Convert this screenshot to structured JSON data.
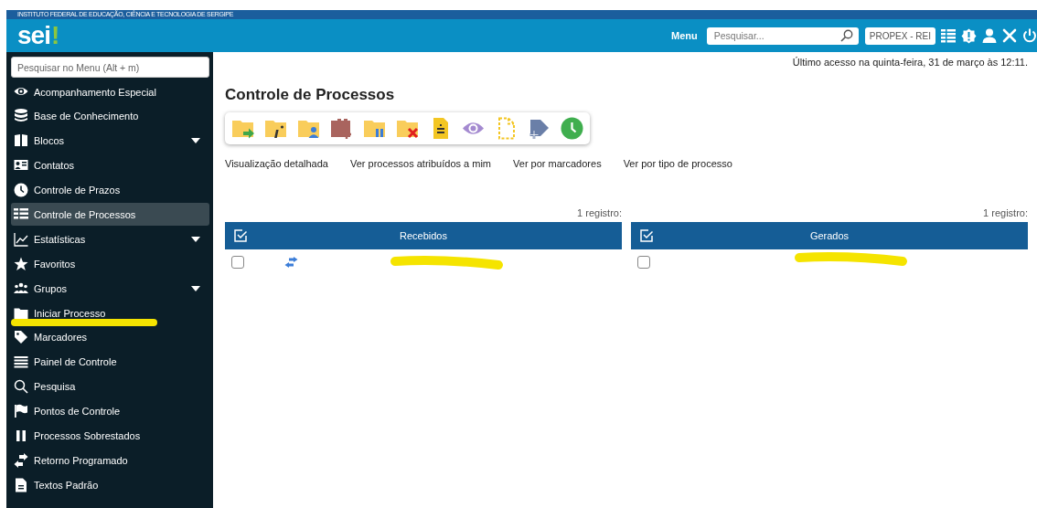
{
  "institution": "INSTITUTO FEDERAL DE EDUCAÇÃO, CIÊNCIA E TECNOLOGIA DE SERGIPE",
  "logo": {
    "text": "sei",
    "mark": "!"
  },
  "header": {
    "menu_label": "Menu",
    "search": {
      "placeholder": "Pesquisar..."
    },
    "unit": "PROPEX - REI"
  },
  "sidebar": {
    "search": {
      "placeholder": "Pesquisar no Menu (Alt + m)"
    },
    "items": [
      {
        "label": "Acompanhamento Especial",
        "selected": false,
        "submenu": false
      },
      {
        "label": "Base de Conhecimento",
        "selected": false,
        "submenu": false
      },
      {
        "label": "Blocos",
        "selected": false,
        "submenu": true
      },
      {
        "label": "Contatos",
        "selected": false,
        "submenu": false
      },
      {
        "label": "Controle de Prazos",
        "selected": false,
        "submenu": false
      },
      {
        "label": "Controle de Processos",
        "selected": true,
        "submenu": false
      },
      {
        "label": "Estatísticas",
        "selected": false,
        "submenu": true
      },
      {
        "label": "Favoritos",
        "selected": false,
        "submenu": false
      },
      {
        "label": "Grupos",
        "selected": false,
        "submenu": true
      },
      {
        "label": "Iniciar Processo",
        "selected": false,
        "submenu": false
      },
      {
        "label": "Marcadores",
        "selected": false,
        "submenu": false
      },
      {
        "label": "Painel de Controle",
        "selected": false,
        "submenu": false
      },
      {
        "label": "Pesquisa",
        "selected": false,
        "submenu": false
      },
      {
        "label": "Pontos de Controle",
        "selected": false,
        "submenu": false
      },
      {
        "label": "Processos Sobrestados",
        "selected": false,
        "submenu": false
      },
      {
        "label": "Retorno Programado",
        "selected": false,
        "submenu": false
      },
      {
        "label": "Textos Padrão",
        "selected": false,
        "submenu": false
      }
    ]
  },
  "last_access": "Último acesso na quinta-feira, 31 de março às 12:11.",
  "page_title": "Controle de Processos",
  "view_links": [
    "Visualização detalhada",
    "Ver processos atribuídos a mim",
    "Ver por marcadores",
    "Ver por tipo de processo"
  ],
  "tables": [
    {
      "count": "1 registro:",
      "heading": "Recebidos",
      "rows": [
        {
          "checked": false,
          "kind": "return"
        }
      ]
    },
    {
      "count": "1 registro:",
      "heading": "Gerados",
      "rows": [
        {
          "checked": false,
          "kind": "plain"
        }
      ]
    }
  ]
}
